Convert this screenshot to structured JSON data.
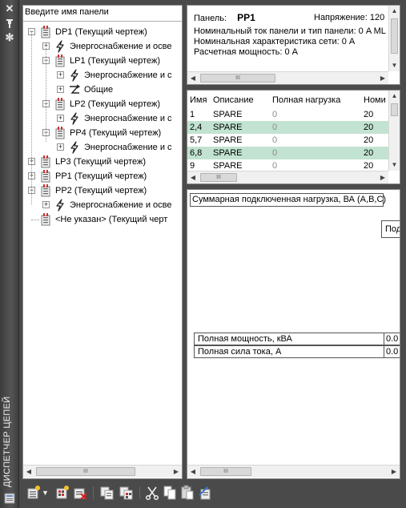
{
  "palette": {
    "title": "ДИСПЕТЧЕР ЦЕПЕЙ",
    "close_icon": "close-icon",
    "autohide_icon": "autohide-icon",
    "properties_icon": "gear-icon"
  },
  "tree": {
    "search_placeholder": "Введите имя панели",
    "nodes": [
      {
        "label": "DP1 (Текущий чертеж)",
        "icon": "panel-icon"
      },
      {
        "label": "Энергоснабжение и осве",
        "icon": "power-icon"
      },
      {
        "label": "LP1 (Текущий чертеж)",
        "icon": "panel-icon"
      },
      {
        "label": "Энергоснабжение и с",
        "icon": "power-icon"
      },
      {
        "label": "Общие",
        "icon": "general-icon"
      },
      {
        "label": "LP2 (Текущий чертеж)",
        "icon": "panel-icon"
      },
      {
        "label": "Энергоснабжение и с",
        "icon": "power-icon"
      },
      {
        "label": "PP4 (Текущий чертеж)",
        "icon": "panel-icon"
      },
      {
        "label": "Энергоснабжение и с",
        "icon": "power-icon"
      },
      {
        "label": "LP3 (Текущий чертеж)",
        "icon": "panel-icon"
      },
      {
        "label": "PP1 (Текущий чертеж)",
        "icon": "panel-icon"
      },
      {
        "label": "PP2 (Текущий чертеж)",
        "icon": "panel-icon"
      },
      {
        "label": "Энергоснабжение и осве",
        "icon": "power-icon"
      },
      {
        "label": "<Не указан> (Текущий черт",
        "icon": "panel-icon"
      }
    ]
  },
  "info": {
    "panel_label": "Панель:",
    "panel_value": "PP1",
    "voltage": "Напряжение: 120",
    "rated_current": "Номинальный ток панели и тип панели: 0 A ML",
    "network_rating": "Номинальная характеристика сети: 0 A",
    "design_power": "Расчетная мощность: 0 A"
  },
  "circuits": {
    "headers": [
      "Имя",
      "Описание",
      "Полная нагрузка",
      "Номи"
    ],
    "rows": [
      {
        "name": "1",
        "desc": "SPARE",
        "load": "0",
        "rating": "20"
      },
      {
        "name": "2,4",
        "desc": "SPARE",
        "load": "0",
        "rating": "20"
      },
      {
        "name": "5,7",
        "desc": "SPARE",
        "load": "0",
        "rating": "20"
      },
      {
        "name": "6,8",
        "desc": "SPARE",
        "load": "0",
        "rating": "20"
      },
      {
        "name": "9",
        "desc": "SPARE",
        "load": "0",
        "rating": "20"
      }
    ]
  },
  "summary": {
    "connected_load": "Суммарная подключенная нагрузка, ВА (A,B,C)",
    "sub_header": "Под",
    "total_power_label": "Полная мощность, кВА",
    "total_power_value": "0.0",
    "total_current_label": "Полная сила тока, А",
    "total_current_value": "0.0"
  },
  "toolbar": {
    "buttons": [
      "new-panel-icon",
      "dropdown-arrow-icon",
      "new-circuit-icon",
      "delete-icon",
      "copy-panel-icon",
      "paste-panel-icon",
      "cut-icon",
      "copy-icon",
      "paste-icon",
      "properties-icon"
    ]
  },
  "colors": {
    "alt_row": "#c2e3d1",
    "background": "#4a4a4a"
  }
}
